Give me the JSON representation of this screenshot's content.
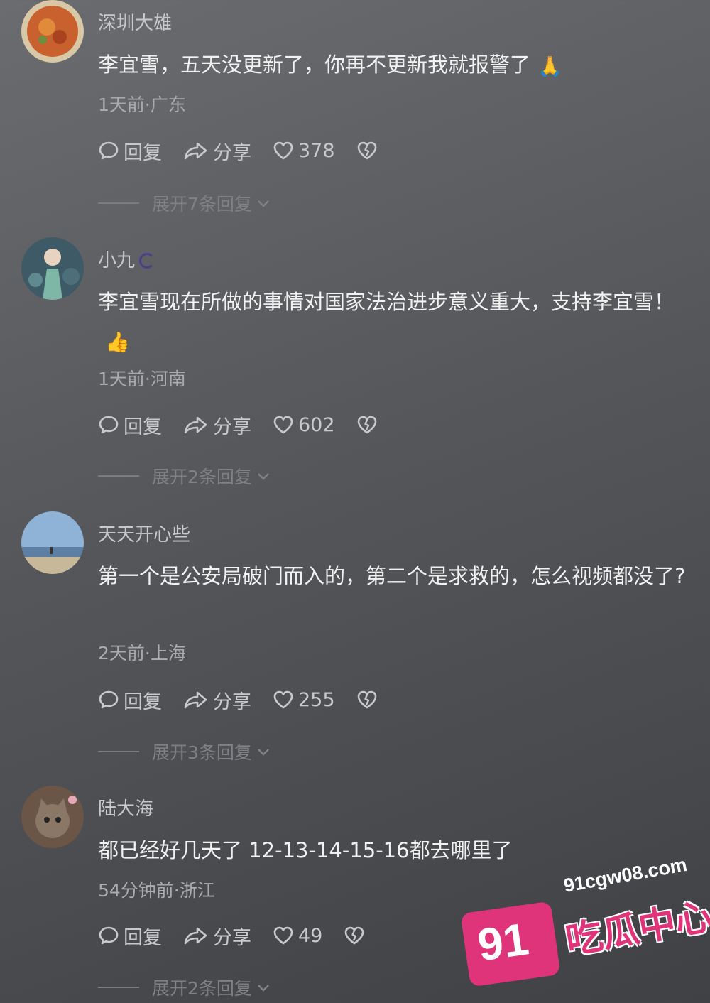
{
  "comments": [
    {
      "username": "深圳大雄",
      "text": "李宜雪，五天没更新了，你再不更新我就报警了",
      "emoji": "🙏",
      "meta": "1天前·广东",
      "reply_label": "回复",
      "share_label": "分享",
      "likes": "378",
      "expand_label": "展开7条回复"
    },
    {
      "username": "小九",
      "text": "李宜雪现在所做的事情对国家法治进步意义重大，支持李宜雪！",
      "emoji": "👍",
      "meta": "1天前·河南",
      "reply_label": "回复",
      "share_label": "分享",
      "likes": "602",
      "expand_label": "展开2条回复"
    },
    {
      "username": "天天开心些",
      "text": "第一个是公安局破门而入的，第二个是求救的，怎么视频都没了?",
      "meta": "2天前·上海",
      "reply_label": "回复",
      "share_label": "分享",
      "likes": "255",
      "expand_label": "展开3条回复"
    },
    {
      "username": "陆大海",
      "text": "都已经好几天了 12-13-14-15-16都去哪里了",
      "meta": "54分钟前·浙江",
      "reply_label": "回复",
      "share_label": "分享",
      "likes": "49",
      "expand_label": "展开2条回复"
    }
  ],
  "watermark": {
    "number": "91",
    "url": "91cgw08.com",
    "name": "吃瓜中心",
    "color": "#e0347a"
  },
  "icons": [
    "reply-bubble-icon",
    "share-arrow-icon",
    "heart-icon",
    "dislike-heart-icon",
    "chevron-down-icon"
  ]
}
